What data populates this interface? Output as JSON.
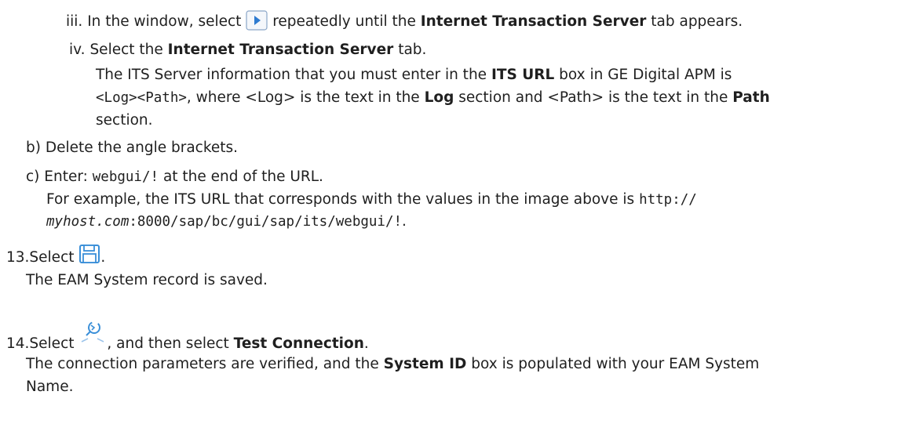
{
  "steps": {
    "iii": {
      "marker": "iii.",
      "text_before": "In the window, select",
      "text_after": "repeatedly until the",
      "bold": "Internet Transaction Server",
      "text_end": "tab appears."
    },
    "iv": {
      "marker": "iv.",
      "text_before": "Select the",
      "bold": "Internet Transaction Server",
      "text_after": "tab.",
      "para_l1_a": "The ITS Server information that you must enter in the",
      "para_l1_bold": "ITS URL",
      "para_l1_b": "box in GE Digital APM is",
      "para_l2_code": "<Log><Path>",
      "para_l2_a": ", where <Log> is the text in the",
      "para_l2_bold1": "Log",
      "para_l2_b": "section and <Path> is the text in the",
      "para_l2_bold2": "Path",
      "para_l3": "section."
    },
    "b": {
      "marker": "b)",
      "text": "Delete the angle brackets."
    },
    "c": {
      "marker": "c)",
      "text_before": "Enter:",
      "code": "webgui/!",
      "text_after": "at the end of the URL.",
      "ex_l1": "For example, the ITS URL that corresponds with the values in the image above is",
      "ex_l1_code": "http://",
      "ex_l2_host": "myhost.com",
      "ex_l2_rest": ":8000/sap/bc/gui/sap/its/webgui/!",
      "ex_l2_end": "."
    },
    "s13": {
      "marker": "13.",
      "text": "Select",
      "end": ".",
      "result": "The EAM System record is saved."
    },
    "s14": {
      "marker": "14.",
      "text_before": "Select",
      "text_after": ", and then select",
      "bold": "Test Connection",
      "end": ".",
      "result_a": "The connection parameters are verified, and the",
      "result_bold": "System ID",
      "result_b": "box is populated with your EAM System",
      "result_l2": "Name."
    }
  },
  "icons": {
    "next": "next-arrow-icon",
    "save": "save-floppy-icon",
    "connect": "connection-icon"
  },
  "colors": {
    "text": "#1f1f1f",
    "icon_blue": "#3a8fd8",
    "icon_border": "#7a9cc6"
  }
}
